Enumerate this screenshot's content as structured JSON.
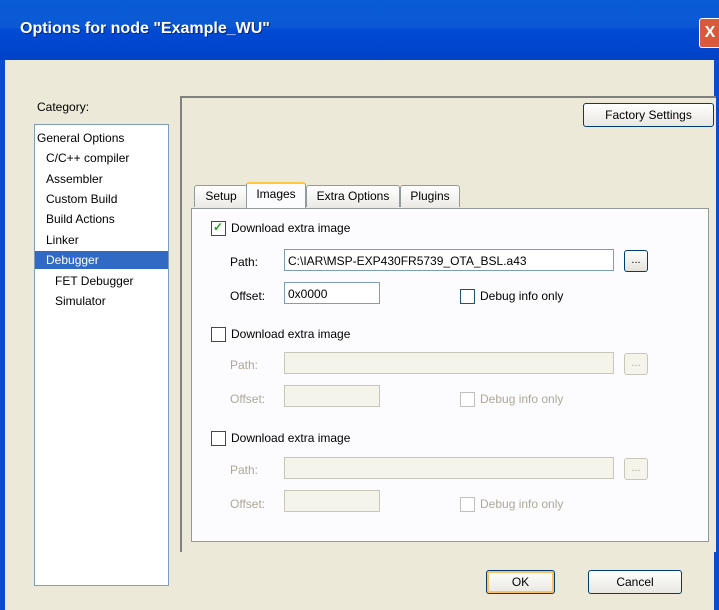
{
  "window": {
    "title": "Options for node \"Example_WU\"",
    "close_glyph": "X"
  },
  "category": {
    "label": "Category:",
    "items": [
      {
        "label": "General Options",
        "indent": 0,
        "selected": false
      },
      {
        "label": "C/C++ compiler",
        "indent": 1,
        "selected": false
      },
      {
        "label": "Assembler",
        "indent": 1,
        "selected": false
      },
      {
        "label": "Custom Build",
        "indent": 1,
        "selected": false
      },
      {
        "label": "Build Actions",
        "indent": 1,
        "selected": false
      },
      {
        "label": "Linker",
        "indent": 1,
        "selected": false
      },
      {
        "label": "Debugger",
        "indent": 1,
        "selected": true
      },
      {
        "label": "FET Debugger",
        "indent": 2,
        "selected": false
      },
      {
        "label": "Simulator",
        "indent": 2,
        "selected": false
      }
    ]
  },
  "factory_settings_label": "Factory Settings",
  "tabs": [
    {
      "label": "Setup",
      "active": false
    },
    {
      "label": "Images",
      "active": true
    },
    {
      "label": "Extra Options",
      "active": false
    },
    {
      "label": "Plugins",
      "active": false
    }
  ],
  "images": [
    {
      "download_label": "Download extra image",
      "download_checked": true,
      "enabled": true,
      "path_label": "Path:",
      "path_value": "C:\\IAR\\MSP-EXP430FR5739_OTA_BSL.a43",
      "browse_label": "...",
      "offset_label": "Offset:",
      "offset_value": "0x0000",
      "debug_info_label": "Debug info only",
      "debug_info_checked": false
    },
    {
      "download_label": "Download extra image",
      "download_checked": false,
      "enabled": false,
      "path_label": "Path:",
      "path_value": "",
      "browse_label": "...",
      "offset_label": "Offset:",
      "offset_value": "",
      "debug_info_label": "Debug info only",
      "debug_info_checked": false
    },
    {
      "download_label": "Download extra image",
      "download_checked": false,
      "enabled": false,
      "path_label": "Path:",
      "path_value": "",
      "browse_label": "...",
      "offset_label": "Offset:",
      "offset_value": "",
      "debug_info_label": "Debug info only",
      "debug_info_checked": false
    }
  ],
  "footer": {
    "ok_label": "OK",
    "cancel_label": "Cancel"
  }
}
